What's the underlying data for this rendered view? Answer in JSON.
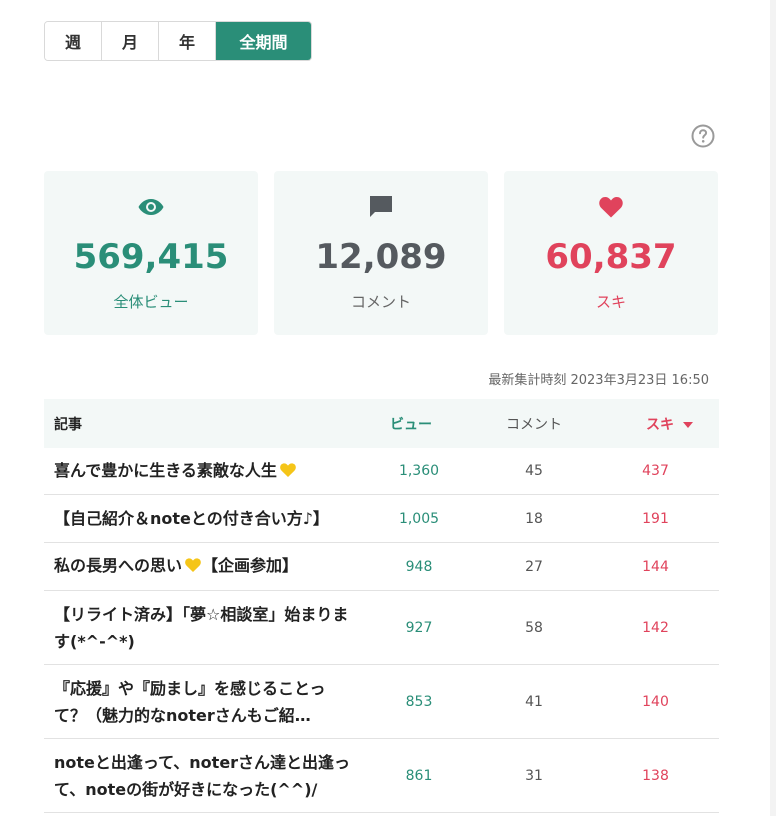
{
  "tabs": [
    {
      "label": "週",
      "active": false
    },
    {
      "label": "月",
      "active": false
    },
    {
      "label": "年",
      "active": false
    },
    {
      "label": "全期間",
      "active": true
    }
  ],
  "stats": {
    "views": {
      "value": "569,415",
      "label": "全体ビュー",
      "icon": "eye-icon",
      "color": "#2a8e78"
    },
    "comments": {
      "value": "12,089",
      "label": "コメント",
      "icon": "comment-icon",
      "color": "#555a5f"
    },
    "likes": {
      "value": "60,837",
      "label": "スキ",
      "icon": "heart-icon",
      "color": "#e0435c"
    }
  },
  "updated_text": "最新集計時刻 2023年3月23日 16:50",
  "table": {
    "headers": {
      "title": "記事",
      "views": "ビュー",
      "comments": "コメント",
      "likes": "スキ"
    },
    "rows": [
      {
        "title": "喜んで豊かに生きる素敵な人生",
        "emoji": "yellow-heart",
        "views": "1,360",
        "comments": "45",
        "likes": "437"
      },
      {
        "title": "【自己紹介＆noteとの付き合い方♪】",
        "views": "1,005",
        "comments": "18",
        "likes": "191"
      },
      {
        "title": "私の長男への思い",
        "title_suffix": "【企画参加】",
        "emoji": "yellow-heart",
        "views": "948",
        "comments": "27",
        "likes": "144"
      },
      {
        "title": "【リライト済み】「夢☆相談室」始まります(*^-^*)",
        "views": "927",
        "comments": "58",
        "likes": "142"
      },
      {
        "title": "『応援』や『励まし』を感じることって？（魅力的なnoterさんもご紹…",
        "views": "853",
        "comments": "41",
        "likes": "140"
      },
      {
        "title": "noteと出逢って、noterさん達と出逢って、noteの街が好きになった(^^)/",
        "views": "861",
        "comments": "31",
        "likes": "138"
      }
    ]
  }
}
